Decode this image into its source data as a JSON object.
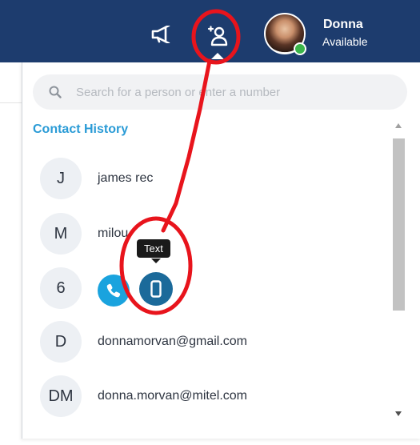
{
  "header": {
    "user": {
      "name": "Donna",
      "status": "Available",
      "status_color": "#3bb54a"
    },
    "icons": [
      "megaphone-icon",
      "contacts-icon"
    ],
    "bar_color": "#1d3c6e"
  },
  "search": {
    "placeholder": "Search for a person or enter a number"
  },
  "contact_history": {
    "title": "Contact History",
    "title_color": "#2a9bd6",
    "items": [
      {
        "initials": "J",
        "name": "james rec"
      },
      {
        "initials": "M",
        "name": "milou"
      },
      {
        "initials": "6",
        "name": ""
      },
      {
        "initials": "D",
        "name": "donnamorvan@gmail.com"
      },
      {
        "initials": "DM",
        "name": "donna.morvan@mitel.com"
      }
    ]
  },
  "hover_actions": {
    "call_icon": "phone-icon",
    "text_icon": "mobile-icon",
    "tooltip": "Text",
    "call_color": "#1aa3de",
    "text_color": "#1b6a9a"
  },
  "annotation": {
    "color": "#e8141c"
  }
}
